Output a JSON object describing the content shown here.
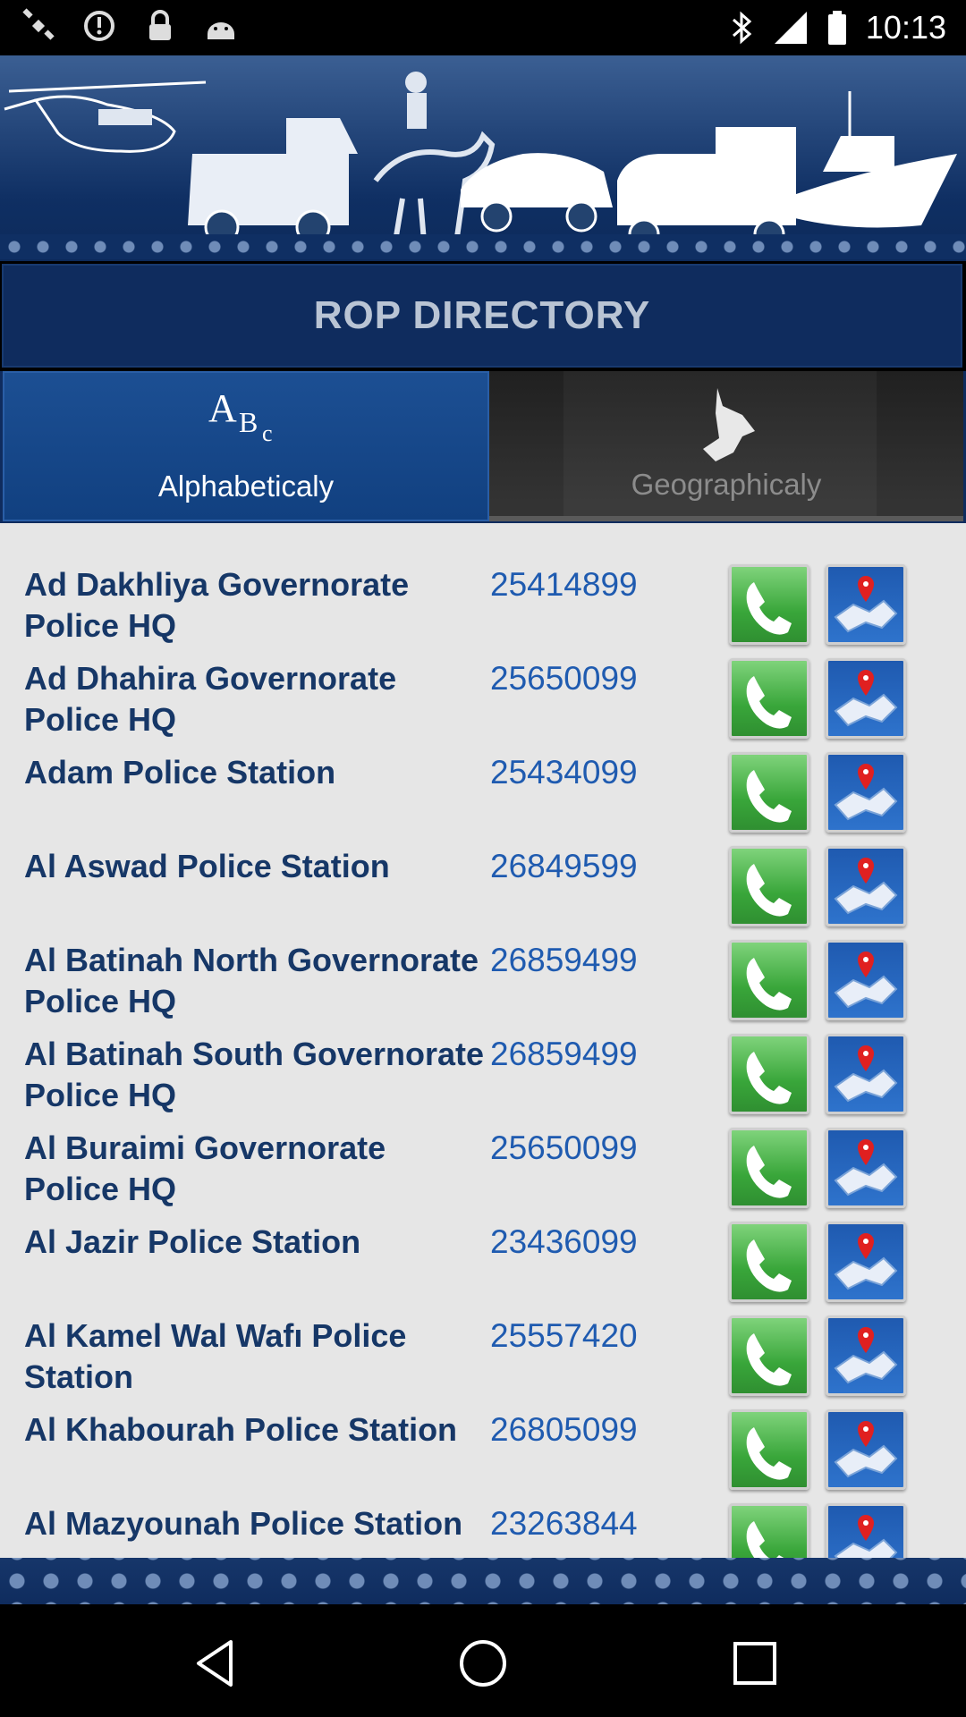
{
  "status_bar": {
    "time": "10:13",
    "left_icons": [
      "satellite-icon",
      "alarm-icon",
      "lock-icon",
      "android-icon"
    ],
    "right_icons": [
      "bluetooth-icon",
      "signal-icon",
      "battery-icon"
    ]
  },
  "header": {
    "title": "ROP DIRECTORY"
  },
  "tabs": [
    {
      "label": "Alphabeticaly",
      "icon": "abc-icon",
      "selected": true
    },
    {
      "label": "Geographicaly",
      "icon": "oman-map-icon",
      "selected": false
    }
  ],
  "entries": [
    {
      "name": "Ad Dakhliya Governorate Police HQ",
      "phone": "25414899"
    },
    {
      "name": "Ad Dhahira Governorate Police HQ",
      "phone": "25650099"
    },
    {
      "name": "Adam Police Station",
      "phone": "25434099"
    },
    {
      "name": "Al Aswad Police Station",
      "phone": "26849599"
    },
    {
      "name": "Al Batinah North Governorate Police HQ",
      "phone": "26859499"
    },
    {
      "name": "Al Batinah South Governorate Police HQ",
      "phone": "26859499"
    },
    {
      "name": "Al Buraimi Governorate Police HQ",
      "phone": "25650099"
    },
    {
      "name": "Al Jazir Police Station",
      "phone": "23436099"
    },
    {
      "name": "Al Kamel Wal Wafı Police Station",
      "phone": "25557420"
    },
    {
      "name": "Al Khabourah Police Station",
      "phone": "26805099"
    },
    {
      "name": "Al Mazyounah Police Station",
      "phone": "23263844"
    }
  ],
  "colors": {
    "primary_navy": "#0f2c5e",
    "tab_selected": "#1c4f93",
    "name_text": "#163767",
    "phone_text": "#1f5bb0",
    "call_green": "#39a63a",
    "map_blue": "#1f5ab0"
  }
}
